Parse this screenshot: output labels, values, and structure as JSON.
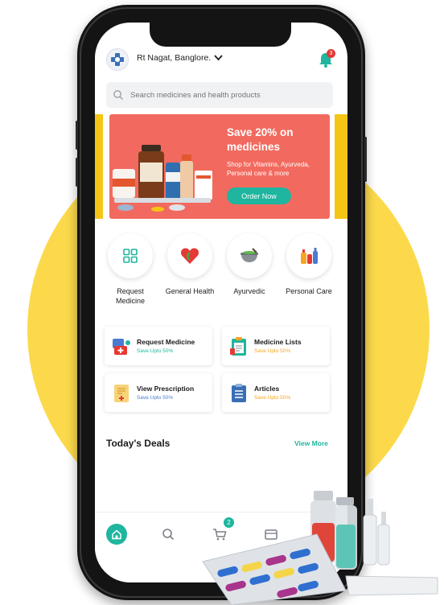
{
  "header": {
    "location": "Rt Nagat, Banglore.",
    "notification_count": "3",
    "icons": [
      "logo-icon",
      "chevron-down-icon",
      "bell-icon"
    ]
  },
  "search": {
    "placeholder": "Search medicines and health products"
  },
  "banner": {
    "title": "Save  20% on medicines",
    "subtitle": "Shop for Vitamins, Ayurveda, Personal care & more",
    "button": "Order Now"
  },
  "categories": [
    {
      "label": "Request Medicine",
      "icon": "grid-icon"
    },
    {
      "label": "General Health",
      "icon": "heart-icon"
    },
    {
      "label": "Ayurvedic",
      "icon": "mortar-icon"
    },
    {
      "label": "Personal Care",
      "icon": "toiletries-icon"
    }
  ],
  "quick_links": [
    {
      "title": "Request Medicine",
      "subtitle": "Save Upto 50%",
      "subtitle_color": "#1fb59e",
      "icon": "medicine-kit-icon"
    },
    {
      "title": "Medicine Lists",
      "subtitle": "Save Upto 50%",
      "subtitle_color": "#f5a623",
      "icon": "clipboard-icon"
    },
    {
      "title": "View Prescription",
      "subtitle": "Save Upto 50%",
      "subtitle_color": "#4a7bd0",
      "icon": "prescription-icon"
    },
    {
      "title": "Articles",
      "subtitle": "Save Upto 50%",
      "subtitle_color": "#f5a623",
      "icon": "article-icon"
    }
  ],
  "deals": {
    "title": "Today's Deals",
    "view_more": "View More"
  },
  "bottom_nav": {
    "cart_count": "2",
    "items": [
      "home-icon",
      "search-icon",
      "cart-icon",
      "wallet-icon"
    ]
  },
  "colors": {
    "accent": "#1fb59e",
    "banner": "#f26a5f",
    "background_circle": "#fcd94b",
    "badge": "#e53935"
  }
}
